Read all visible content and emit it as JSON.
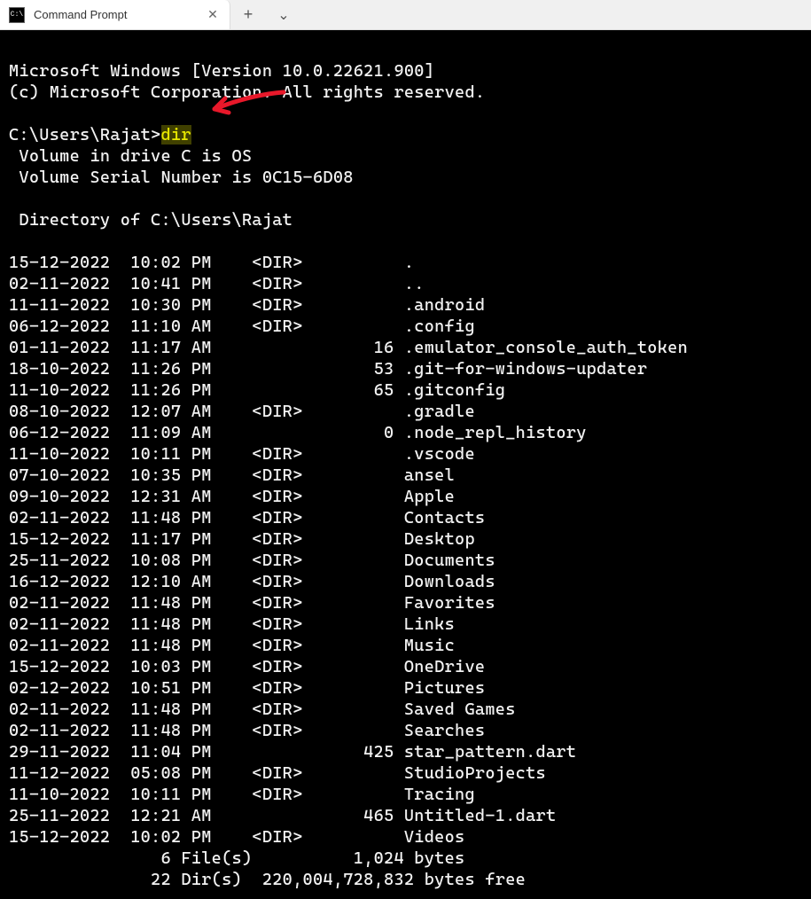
{
  "titlebar": {
    "tab_title": "Command Prompt",
    "tab_icon_text": "C:\\",
    "close_glyph": "✕",
    "add_glyph": "+",
    "dropdown_glyph": "⌄"
  },
  "terminal": {
    "banner1": "Microsoft Windows [Version 10.0.22621.900]",
    "banner2": "(c) Microsoft Corporation. All rights reserved.",
    "prompt": "C:\\Users\\Rajat>",
    "command": "dir",
    "vol_line": " Volume in drive C is OS",
    "serial_line": " Volume Serial Number is 0C15-6D08",
    "dir_of": " Directory of C:\\Users\\Rajat",
    "entries": [
      {
        "date": "15-12-2022",
        "time": "10:02 PM",
        "dir": "<DIR>",
        "size": "",
        "name": "."
      },
      {
        "date": "02-11-2022",
        "time": "10:41 PM",
        "dir": "<DIR>",
        "size": "",
        "name": ".."
      },
      {
        "date": "11-11-2022",
        "time": "10:30 PM",
        "dir": "<DIR>",
        "size": "",
        "name": ".android"
      },
      {
        "date": "06-12-2022",
        "time": "11:10 AM",
        "dir": "<DIR>",
        "size": "",
        "name": ".config"
      },
      {
        "date": "01-11-2022",
        "time": "11:17 AM",
        "dir": "",
        "size": "16",
        "name": ".emulator_console_auth_token"
      },
      {
        "date": "18-10-2022",
        "time": "11:26 PM",
        "dir": "",
        "size": "53",
        "name": ".git-for-windows-updater"
      },
      {
        "date": "11-10-2022",
        "time": "11:26 PM",
        "dir": "",
        "size": "65",
        "name": ".gitconfig"
      },
      {
        "date": "08-10-2022",
        "time": "12:07 AM",
        "dir": "<DIR>",
        "size": "",
        "name": ".gradle"
      },
      {
        "date": "06-12-2022",
        "time": "11:09 AM",
        "dir": "",
        "size": "0",
        "name": ".node_repl_history"
      },
      {
        "date": "11-10-2022",
        "time": "10:11 PM",
        "dir": "<DIR>",
        "size": "",
        "name": ".vscode"
      },
      {
        "date": "07-10-2022",
        "time": "10:35 PM",
        "dir": "<DIR>",
        "size": "",
        "name": "ansel"
      },
      {
        "date": "09-10-2022",
        "time": "12:31 AM",
        "dir": "<DIR>",
        "size": "",
        "name": "Apple"
      },
      {
        "date": "02-11-2022",
        "time": "11:48 PM",
        "dir": "<DIR>",
        "size": "",
        "name": "Contacts"
      },
      {
        "date": "15-12-2022",
        "time": "11:17 PM",
        "dir": "<DIR>",
        "size": "",
        "name": "Desktop"
      },
      {
        "date": "25-11-2022",
        "time": "10:08 PM",
        "dir": "<DIR>",
        "size": "",
        "name": "Documents"
      },
      {
        "date": "16-12-2022",
        "time": "12:10 AM",
        "dir": "<DIR>",
        "size": "",
        "name": "Downloads"
      },
      {
        "date": "02-11-2022",
        "time": "11:48 PM",
        "dir": "<DIR>",
        "size": "",
        "name": "Favorites"
      },
      {
        "date": "02-11-2022",
        "time": "11:48 PM",
        "dir": "<DIR>",
        "size": "",
        "name": "Links"
      },
      {
        "date": "02-11-2022",
        "time": "11:48 PM",
        "dir": "<DIR>",
        "size": "",
        "name": "Music"
      },
      {
        "date": "15-12-2022",
        "time": "10:03 PM",
        "dir": "<DIR>",
        "size": "",
        "name": "OneDrive"
      },
      {
        "date": "02-12-2022",
        "time": "10:51 PM",
        "dir": "<DIR>",
        "size": "",
        "name": "Pictures"
      },
      {
        "date": "02-11-2022",
        "time": "11:48 PM",
        "dir": "<DIR>",
        "size": "",
        "name": "Saved Games"
      },
      {
        "date": "02-11-2022",
        "time": "11:48 PM",
        "dir": "<DIR>",
        "size": "",
        "name": "Searches"
      },
      {
        "date": "29-11-2022",
        "time": "11:04 PM",
        "dir": "",
        "size": "425",
        "name": "star_pattern.dart"
      },
      {
        "date": "11-12-2022",
        "time": "05:08 PM",
        "dir": "<DIR>",
        "size": "",
        "name": "StudioProjects"
      },
      {
        "date": "11-10-2022",
        "time": "10:11 PM",
        "dir": "<DIR>",
        "size": "",
        "name": "Tracing"
      },
      {
        "date": "25-11-2022",
        "time": "12:21 AM",
        "dir": "",
        "size": "465",
        "name": "Untitled-1.dart"
      },
      {
        "date": "15-12-2022",
        "time": "10:02 PM",
        "dir": "<DIR>",
        "size": "",
        "name": "Videos"
      }
    ],
    "summary_files": "               6 File(s)          1,024 bytes",
    "summary_dirs": "              22 Dir(s)  220,004,728,832 bytes free"
  }
}
